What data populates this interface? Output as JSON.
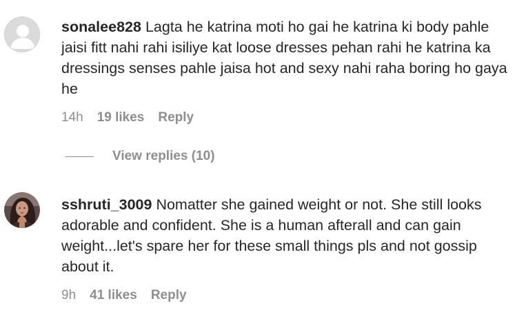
{
  "comments": [
    {
      "username": "sonalee828",
      "text": "Lagta he katrina moti ho gai he katrina ki body pahle jaisi fitt nahi rahi isiliye kat loose dresses pehan rahi he katrina ka dressings senses pahle jaisa hot and sexy nahi raha boring ho gaya he",
      "time": "14h",
      "likes": "19 likes",
      "reply_label": "Reply",
      "view_replies_label": "View replies (10)",
      "avatar": "default-avatar-icon"
    },
    {
      "username": "sshruti_3009",
      "text": "Nomatter she gained weight or not. She still looks adorable and confident. She is a human afterall and can gain weight...let's spare her for these small things pls and not gossip about it.",
      "time": "9h",
      "likes": "41 likes",
      "reply_label": "Reply",
      "avatar": "profile-photo"
    }
  ],
  "colors": {
    "text": "#262626",
    "secondary": "#8e8e8e",
    "default_avatar_bg": "#dbdbdb"
  }
}
